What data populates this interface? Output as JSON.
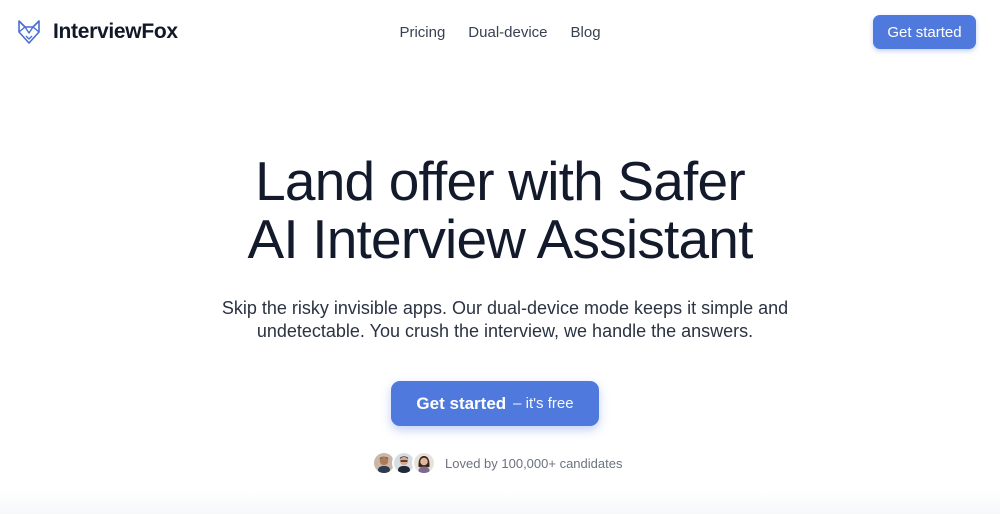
{
  "header": {
    "logo_icon": "fox-icon",
    "brand": "InterviewFox",
    "nav": [
      "Pricing",
      "Dual-device",
      "Blog"
    ],
    "cta_label": "Get started"
  },
  "hero": {
    "title_line1": "Land offer with Safer",
    "title_line2": "AI Interview Assistant",
    "subtitle": "Skip the risky invisible apps. Our dual-device mode keeps it simple and undetectable. You crush the interview, we handle the answers.",
    "cta_main": "Get started",
    "cta_sub": "– it's free",
    "social_proof": "Loved by 100,000+ candidates",
    "avatars": [
      "avatar-man-1",
      "avatar-man-2",
      "avatar-woman"
    ]
  },
  "colors": {
    "accent": "#5079dd",
    "text_dark": "#131a2b",
    "text_muted": "#6b7280"
  }
}
